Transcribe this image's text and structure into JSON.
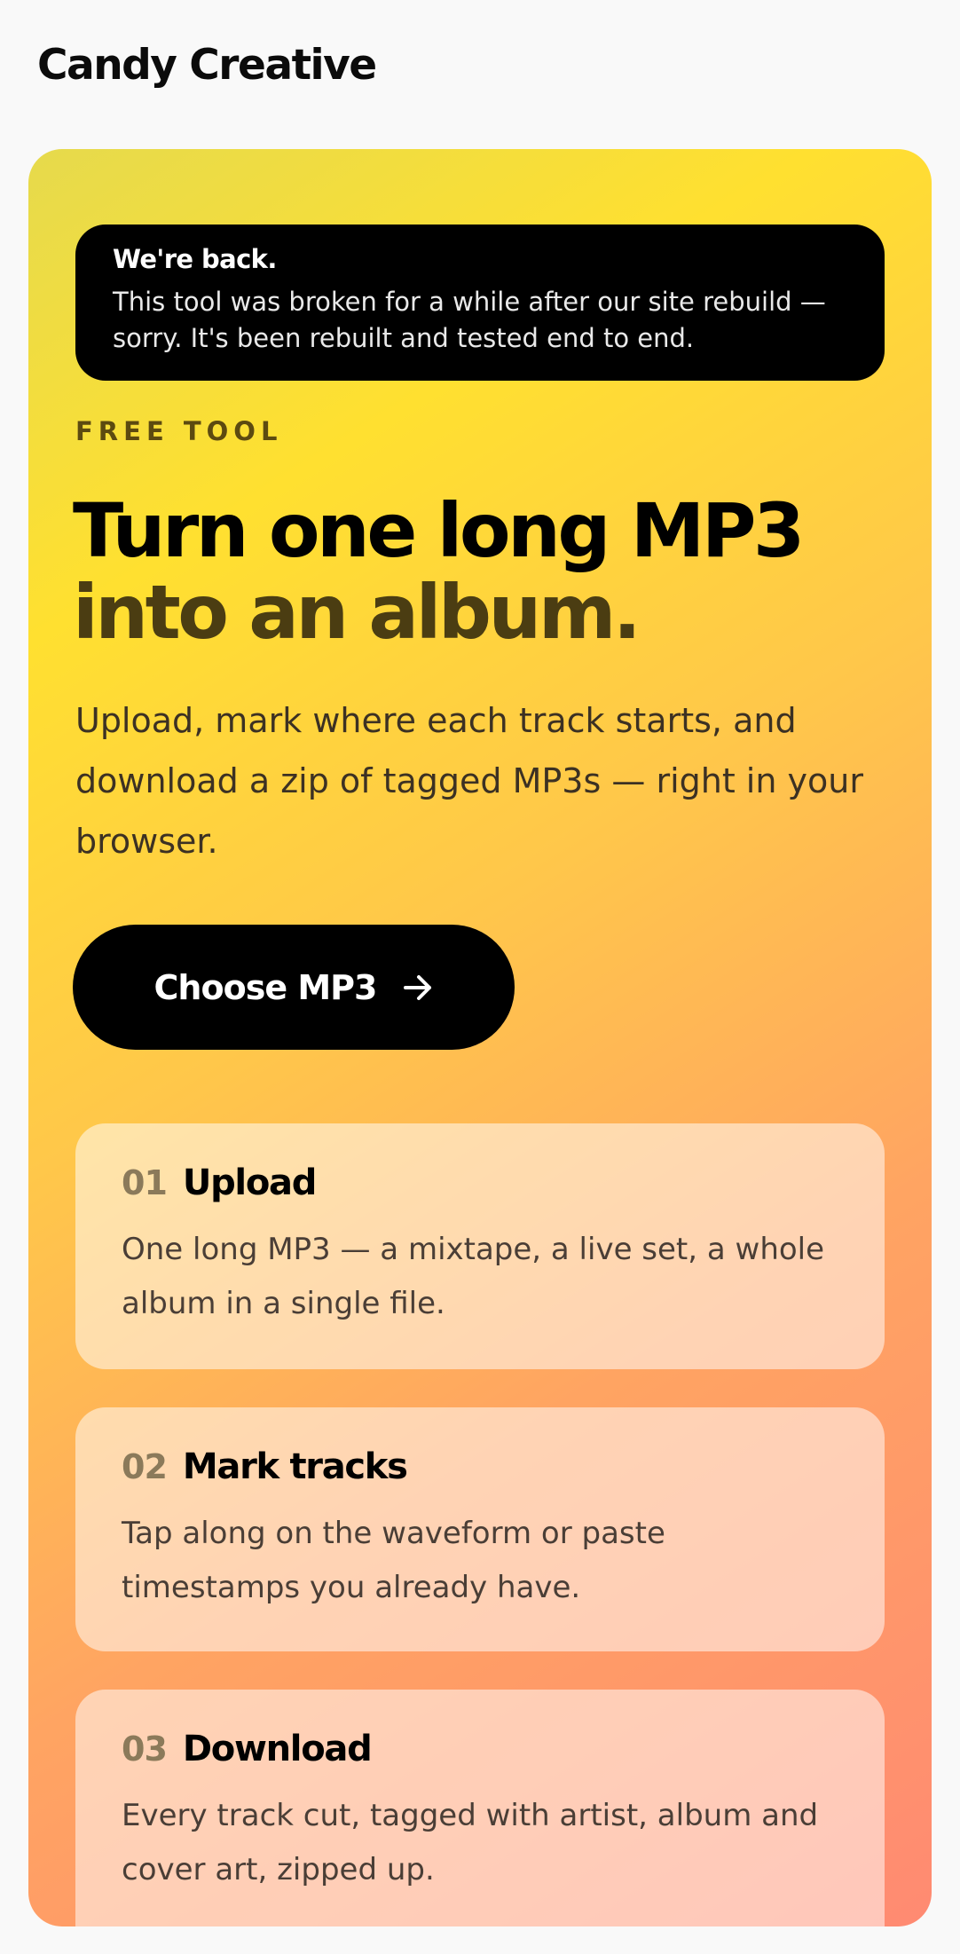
{
  "brand": "Candy Creative",
  "notice": {
    "title": "We're back.",
    "text": "This tool was broken for a while after our site rebuild — sorry. It's been rebuilt and tested end to end."
  },
  "hero": {
    "eyebrow": "FREE TOOL",
    "headline_line1": "Turn one long MP3",
    "headline_line2": "into an album.",
    "lede": "Upload, mark where each track starts, and download a zip of tagged MP3s — right in your browser.",
    "cta_label": "Choose MP3",
    "cta_icon": "arrow-right-icon"
  },
  "steps": [
    {
      "num": "01",
      "title": "Upload",
      "text": "One long MP3 — a mixtape, a live set, a whole album in a single file."
    },
    {
      "num": "02",
      "title": "Mark tracks",
      "text": "Tap along on the waveform or paste timestamps you already have."
    },
    {
      "num": "03",
      "title": "Download",
      "text": "Every track cut, tagged with artist, album and cover art, zipped up."
    }
  ],
  "colors": {
    "gradient_start": "#e6da4c",
    "gradient_yellow": "#ffe030",
    "gradient_end": "#ff8a72",
    "button": "#000000",
    "notice_bg": "#000000"
  }
}
